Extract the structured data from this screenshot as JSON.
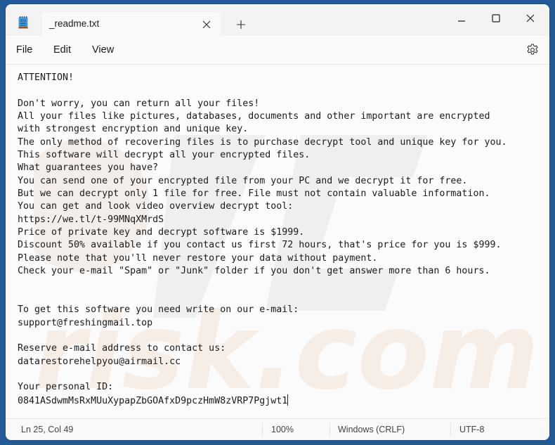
{
  "window": {
    "tab_title": "_readme.txt",
    "app_icon": "notepad-icon",
    "new_tab_icon": "plus-icon",
    "tab_close_icon": "close-icon",
    "controls": [
      "minimize-icon",
      "maximize-icon",
      "close-icon"
    ]
  },
  "menu": {
    "items": [
      {
        "label": "File"
      },
      {
        "label": "Edit"
      },
      {
        "label": "View"
      }
    ],
    "settings_icon": "gear-icon"
  },
  "document": {
    "lines": [
      "ATTENTION!",
      "",
      "Don't worry, you can return all your files!",
      "All your files like pictures, databases, documents and other important are encrypted",
      "with strongest encryption and unique key.",
      "The only method of recovering files is to purchase decrypt tool and unique key for you.",
      "This software will decrypt all your encrypted files.",
      "What guarantees you have?",
      "You can send one of your encrypted file from your PC and we decrypt it for free.",
      "But we can decrypt only 1 file for free. File must not contain valuable information.",
      "You can get and look video overview decrypt tool:",
      "https://we.tl/t-99MNqXMrdS",
      "Price of private key and decrypt software is $1999.",
      "Discount 50% available if you contact us first 72 hours, that's price for you is $999.",
      "Please note that you'll never restore your data without payment.",
      "Check your e-mail \"Spam\" or \"Junk\" folder if you don't get answer more than 6 hours.",
      "",
      "",
      "To get this software you need write on our e-mail:",
      "support@freshingmail.top",
      "",
      "Reserve e-mail address to contact us:",
      "datarestorehelpyou@airmail.cc",
      "",
      "Your personal ID:",
      "0841ASdwmMsRxMUuXypapZbGOAfxD9pczHmW8zVRP7Pgjwt1"
    ]
  },
  "status": {
    "position": "Ln 25, Col 49",
    "zoom": "100%",
    "line_endings": "Windows (CRLF)",
    "encoding": "UTF-8"
  },
  "colors": {
    "desktop": "#235a96",
    "chrome": "#f3f3f3",
    "editor": "#fbfbfb",
    "watermark": "#f0e9e4"
  }
}
